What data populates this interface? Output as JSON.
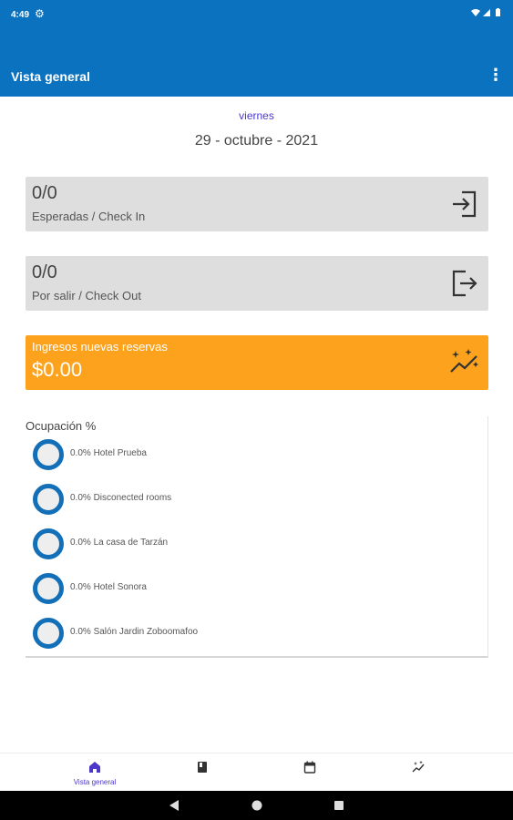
{
  "status_bar": {
    "time": "4:49",
    "gear_icon": "gear-icon",
    "system_icons": "wifi, signal, battery"
  },
  "app_bar": {
    "title": "Vista general",
    "menu_icon": "more-vert-icon"
  },
  "header": {
    "day": "viernes",
    "date": "29 - octubre - 2021"
  },
  "cards": {
    "check_in": {
      "value": "0/0",
      "label": "Esperadas / Check In",
      "icon": "login-icon"
    },
    "check_out": {
      "value": "0/0",
      "label": "Por salir / Check Out",
      "icon": "logout-icon"
    }
  },
  "revenue": {
    "label": "Ingresos nuevas reservas",
    "value": "$0.00",
    "icon": "trending-sparkle-icon",
    "color": "#fca21d"
  },
  "occupancy": {
    "heading": "Ocupación %",
    "items": [
      {
        "text": "0.0% Hotel Prueba",
        "percent": 0.0
      },
      {
        "text": "0.0% Disconected rooms",
        "percent": 0.0
      },
      {
        "text": "0.0% La casa de Tarzán",
        "percent": 0.0
      },
      {
        "text": "0.0% Hotel Sonora",
        "percent": 0.0
      },
      {
        "text": "0.0% Salón Jardin Zoboomafoo",
        "percent": 0.0
      }
    ]
  },
  "bottom_nav": {
    "items": [
      {
        "label": "Vista general",
        "icon": "home-icon",
        "active": true
      },
      {
        "label": "",
        "icon": "book-icon",
        "active": false
      },
      {
        "label": "",
        "icon": "calendar-icon",
        "active": false
      },
      {
        "label": "",
        "icon": "trending-icon",
        "active": false
      }
    ]
  },
  "colors": {
    "primary": "#0b72bf",
    "accent": "#4b38c9",
    "ring": "#136fb7"
  }
}
